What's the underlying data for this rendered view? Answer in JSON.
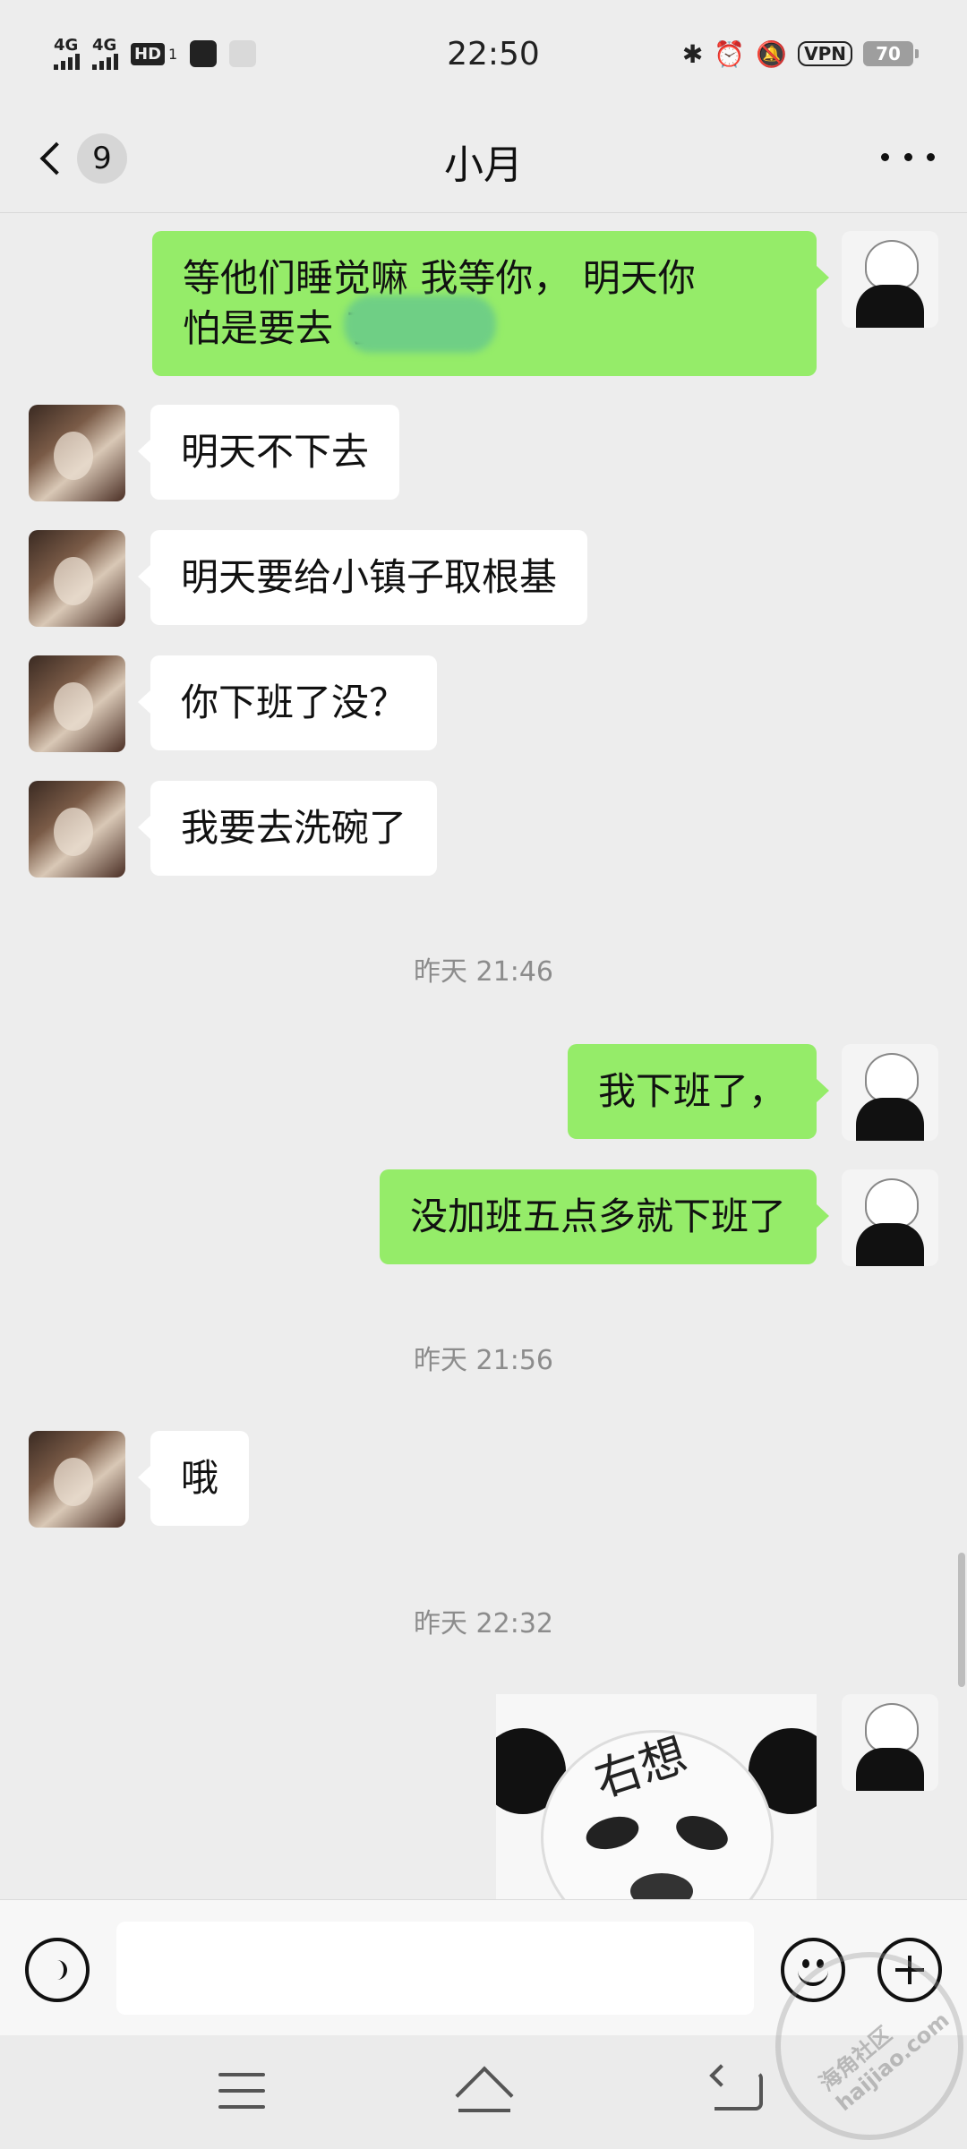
{
  "status_bar": {
    "network1": "4G",
    "network2": "4G",
    "hd": "HD",
    "sim": "1",
    "time": "22:50",
    "vpn": "VPN",
    "battery": "70"
  },
  "header": {
    "unread_count": "9",
    "title": "小月"
  },
  "messages": [
    {
      "sender": "me",
      "text_line1": "等他们睡觉嘛        我等你， 明天你",
      "text_line2": "怕是要去           了"
    },
    {
      "sender": "her",
      "text": "明天不下去"
    },
    {
      "sender": "her",
      "text": "明天要给小镇子取根基"
    },
    {
      "sender": "her",
      "text": "你下班了没？"
    },
    {
      "sender": "her",
      "text": "我要去洗碗了"
    },
    {
      "type": "timestamp",
      "text": "昨天 21:46"
    },
    {
      "sender": "me",
      "text": "我下班了，"
    },
    {
      "sender": "me",
      "text": "没加班五点多就下班了"
    },
    {
      "type": "timestamp",
      "text": "昨天 21:56"
    },
    {
      "sender": "her",
      "text": "哦"
    },
    {
      "type": "timestamp",
      "text": "昨天 22:32"
    },
    {
      "sender": "me",
      "type": "sticker",
      "sticker_text": "右想"
    }
  ],
  "input": {
    "value": "",
    "placeholder": ""
  },
  "watermark": {
    "text": "海角社区 haijiao.com"
  },
  "colors": {
    "background": "#ededed",
    "outgoing_bubble": "#95ec69",
    "incoming_bubble": "#ffffff",
    "timestamp": "#8c8c8c"
  },
  "icons": [
    "back-chevron-icon",
    "more-icon",
    "voice-icon",
    "emoji-icon",
    "plus-icon",
    "menu-icon",
    "home-icon",
    "back-nav-icon",
    "bluetooth-icon",
    "alarm-icon",
    "mute-icon"
  ]
}
